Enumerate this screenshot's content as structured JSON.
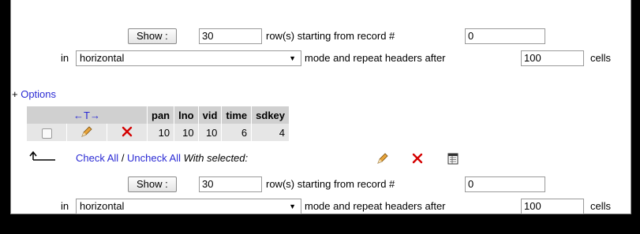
{
  "top_nav": {
    "show_button": "Show :",
    "rows_value": "30",
    "rows_text": "row(s) starting from record #",
    "start_value": "0",
    "in_text": "in",
    "mode_value": "horizontal",
    "mode_text": "mode and repeat headers after",
    "repeat_value": "100",
    "cells_text": "cells"
  },
  "options": {
    "plus": "+",
    "label": "Options"
  },
  "table": {
    "sort_arrows": "←T→",
    "columns": [
      "pan",
      "lno",
      "vid",
      "time",
      "sdkey"
    ],
    "rows": [
      [
        "10",
        "10",
        "10",
        "6",
        "4"
      ]
    ]
  },
  "bulk": {
    "arrow": "⮤",
    "check_all": "Check All",
    "separator": " / ",
    "uncheck_all": "Uncheck All",
    "with_selected": "With selected:"
  },
  "bottom_nav": {
    "show_button": "Show :",
    "rows_value": "30",
    "rows_text": "row(s) starting from record #",
    "start_value": "0",
    "in_text": "in",
    "mode_value": "horizontal",
    "mode_text": "mode and repeat headers after",
    "repeat_value": "100",
    "cells_text": "cells"
  },
  "colors": {
    "link": "#2a2ad4",
    "header_bg": "#d0d0d0",
    "row_bg": "#e6e6e6",
    "delete_red": "#d40000"
  }
}
